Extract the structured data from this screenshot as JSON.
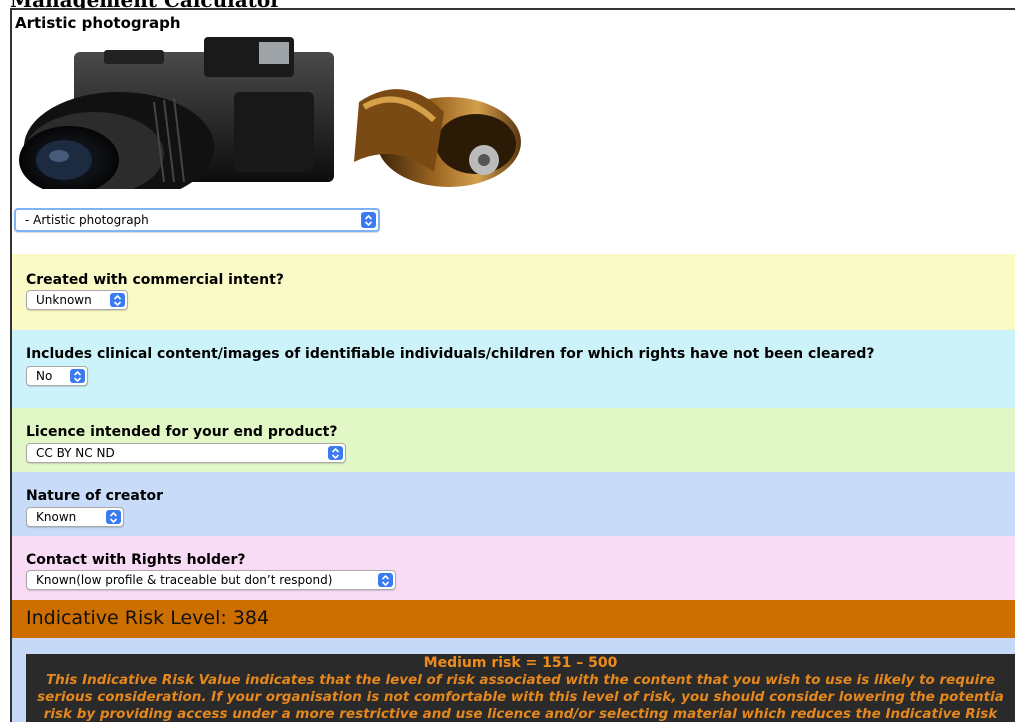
{
  "page": {
    "heading": "Management Calculator"
  },
  "content": {
    "title": "Artistic photograph",
    "image_alt": "camera and film rolls",
    "type_select": {
      "value": "- Artistic photograph"
    }
  },
  "questions": [
    {
      "label": "Created with commercial intent?",
      "value": "Unknown",
      "bg": "#fafac6"
    },
    {
      "label": "Includes clinical content/images of identifiable individuals/children for which rights have not been cleared?",
      "value": "No",
      "bg": "#cdf3fa"
    },
    {
      "label": "Licence intended for your end product?",
      "value": "CC BY NC ND",
      "bg": "#e2f7c6"
    },
    {
      "label": "Nature of creator",
      "value": "Known",
      "bg": "#c8dbf8"
    },
    {
      "label": "Contact with Rights holder?",
      "value": "Known(low profile & traceable but don’t respond)",
      "bg": "#f8dbf4"
    }
  ],
  "risk": {
    "label": "Indicative Risk Level: 384",
    "band_color": "#cc6e00",
    "level_title": "Medium risk = 151 – 500",
    "description_lines": [
      "This Indicative Risk Value indicates that the level of risk associated with the content that you wish to use is likely to require",
      "serious consideration. If your organisation is not comfortable with this level of risk, you should consider lowering the potentia",
      "risk by providing access under a more restrictive and use licence and/or selecting material which reduces the Indicative Risk"
    ]
  },
  "icons": {
    "select_arrow": "chevron-updown-icon"
  }
}
